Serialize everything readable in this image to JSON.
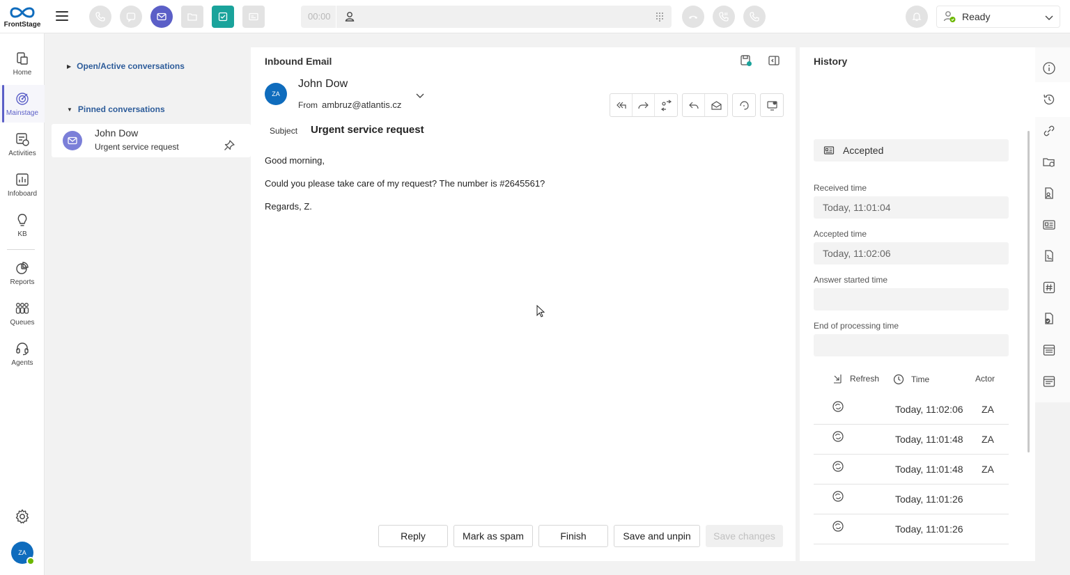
{
  "app": {
    "brand": "FrontStage"
  },
  "topbar": {
    "timer": "00:00",
    "status": "Ready",
    "accent": "#5b5fc7",
    "teal": "#1aa39b"
  },
  "nav": {
    "items": [
      {
        "label": "Home",
        "icon": "home-icon"
      },
      {
        "label": "Mainstage",
        "icon": "target-icon"
      },
      {
        "label": "Activities",
        "icon": "activities-icon"
      },
      {
        "label": "Infoboard",
        "icon": "chart-icon"
      },
      {
        "label": "KB",
        "icon": "lightbulb-icon"
      },
      {
        "label": "Reports",
        "icon": "pie-icon"
      },
      {
        "label": "Queues",
        "icon": "queues-icon"
      },
      {
        "label": "Agents",
        "icon": "headset-icon"
      }
    ],
    "user_initials": "ZA"
  },
  "conversations": {
    "open_label": "Open/Active conversations",
    "pinned_label": "Pinned conversations",
    "pinned": [
      {
        "name": "John Dow",
        "subject": "Urgent service request"
      }
    ]
  },
  "email": {
    "title": "Inbound Email",
    "sender_initials": "ZA",
    "sender_name": "John Dow",
    "from_label": "From",
    "from_address": "ambruz@atlantis.cz",
    "subject_label": "Subject",
    "subject": "Urgent service request",
    "body": [
      "Good morning,",
      "Could you please take care of my request? The number is #2645561?",
      "Regards, Z."
    ],
    "buttons": {
      "reply": "Reply",
      "spam": "Mark as spam",
      "finish": "Finish",
      "save_unpin": "Save and unpin",
      "save_changes": "Save changes"
    }
  },
  "history": {
    "title": "History",
    "state": "Accepted",
    "fields": [
      {
        "label": "Received time",
        "value": "Today, 11:01:04"
      },
      {
        "label": "Accepted time",
        "value": "Today, 11:02:06"
      },
      {
        "label": "Answer started time",
        "value": ""
      },
      {
        "label": "End of processing time",
        "value": ""
      }
    ],
    "columns": {
      "refresh": "Refresh",
      "time": "Time",
      "actor": "Actor"
    },
    "rows": [
      {
        "time": "Today, 11:02:06",
        "actor": "ZA"
      },
      {
        "time": "Today, 11:01:48",
        "actor": "ZA"
      },
      {
        "time": "Today, 11:01:48",
        "actor": "ZA"
      },
      {
        "time": "Today, 11:01:26",
        "actor": ""
      },
      {
        "time": "Today, 11:01:26",
        "actor": ""
      }
    ]
  }
}
